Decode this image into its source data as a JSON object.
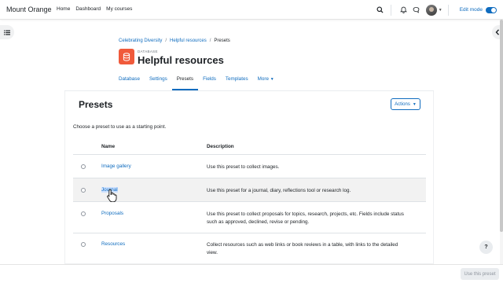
{
  "brand": {
    "name": "Mount Orange"
  },
  "primary_nav": [
    {
      "label": "Home"
    },
    {
      "label": "Dashboard"
    },
    {
      "label": "My courses"
    }
  ],
  "navbar": {
    "icons": [
      "search-icon",
      "bell-icon",
      "chat-icon",
      "avatar",
      "chevron-down-icon"
    ],
    "edit_mode_label": "Edit mode",
    "edit_mode_on": true
  },
  "breadcrumb": [
    "Celebrating Diversity",
    "Helpful resources",
    "Presets"
  ],
  "activity": {
    "type_label": "DATABASE",
    "title": "Helpful resources",
    "icon": "database-icon",
    "icon_color": "#f05a3b"
  },
  "tabs": [
    {
      "label": "Database",
      "active": false
    },
    {
      "label": "Settings",
      "active": false
    },
    {
      "label": "Presets",
      "active": true
    },
    {
      "label": "Fields",
      "active": false
    },
    {
      "label": "Templates",
      "active": false
    },
    {
      "label": "More",
      "active": false
    }
  ],
  "section": {
    "title": "Presets",
    "actions_label": "Actions",
    "intro": "Choose a preset to use as a starting point."
  },
  "table": {
    "columns": [
      "Name",
      "Description"
    ],
    "rows": [
      {
        "name": "Image gallery",
        "description": "Use this preset to collect images."
      },
      {
        "name": "Journal",
        "description": "Use this preset for a journal, diary, reflections tool or research log."
      },
      {
        "name": "Proposals",
        "description": "Use this preset to collect proposals for topics, research, projects, etc. Fields include status such as approved, declined, revise or pending."
      },
      {
        "name": "Resources",
        "description": "Collect resources such as web links or book reviews in a table, with links to the detailed view."
      }
    ]
  },
  "footer": {
    "use_button_label": "Use this preset",
    "help_label": "?"
  },
  "colors": {
    "accent": "#0f6cbf",
    "text": "#1d2125"
  }
}
